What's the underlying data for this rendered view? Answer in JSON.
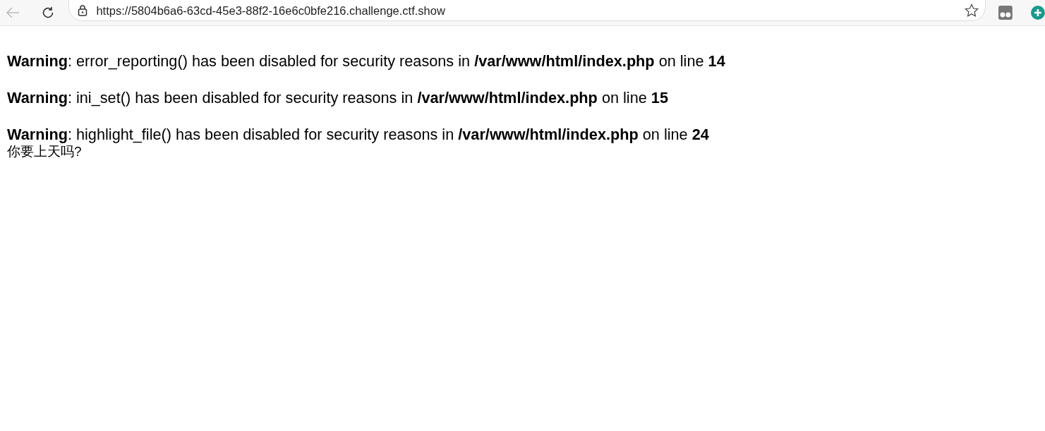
{
  "toolbar": {
    "back_disabled": true,
    "url": "https://5804b6a6-63cd-45e3-88f2-16e6c0bfe216.challenge.ctf.show"
  },
  "warnings": [
    {
      "text": "**Warning**: error_reporting() has been disabled for security reasons in **/var/www/html/index.php** on line **14**"
    },
    {
      "text": "**Warning**: ini_set() has been disabled for security reasons in **/var/www/html/index.php** on line **15**"
    },
    {
      "text": "**Warning**: highlight_file() has been disabled for security reasons in **/var/www/html/index.php** on line **24**"
    }
  ],
  "output": "你要上天吗?"
}
